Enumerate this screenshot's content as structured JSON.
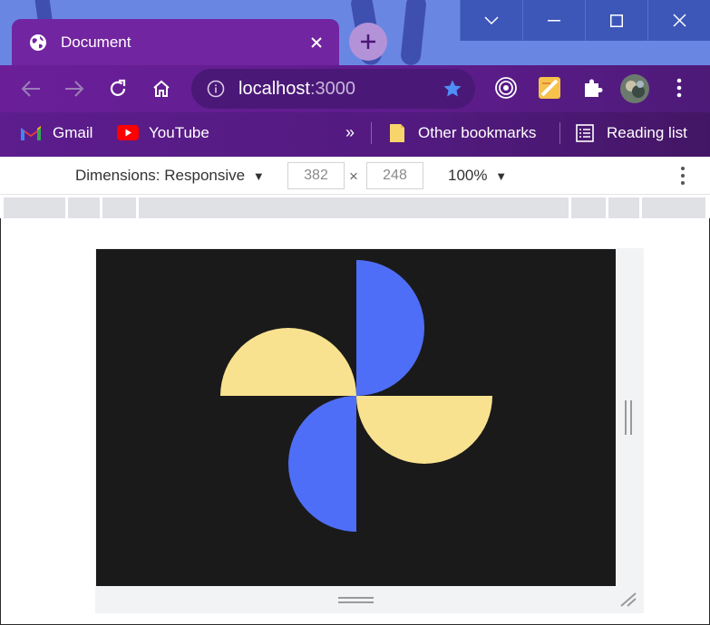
{
  "tab": {
    "title": "Document"
  },
  "omnibox": {
    "host": "localhost",
    "port": ":3000"
  },
  "bookmarks": [
    {
      "label": "Gmail"
    },
    {
      "label": "YouTube"
    }
  ],
  "bookmarks_overflow": "»",
  "other_bookmarks": "Other bookmarks",
  "reading_list": "Reading list",
  "devtools": {
    "dimensions_label": "Dimensions: Responsive",
    "width": "382",
    "height": "248",
    "times": "×",
    "zoom": "100%"
  },
  "colors": {
    "blue_blade": "#4f6ef7",
    "yellow_blade": "#f9e28f",
    "viewport_bg": "#1a1a1a"
  }
}
